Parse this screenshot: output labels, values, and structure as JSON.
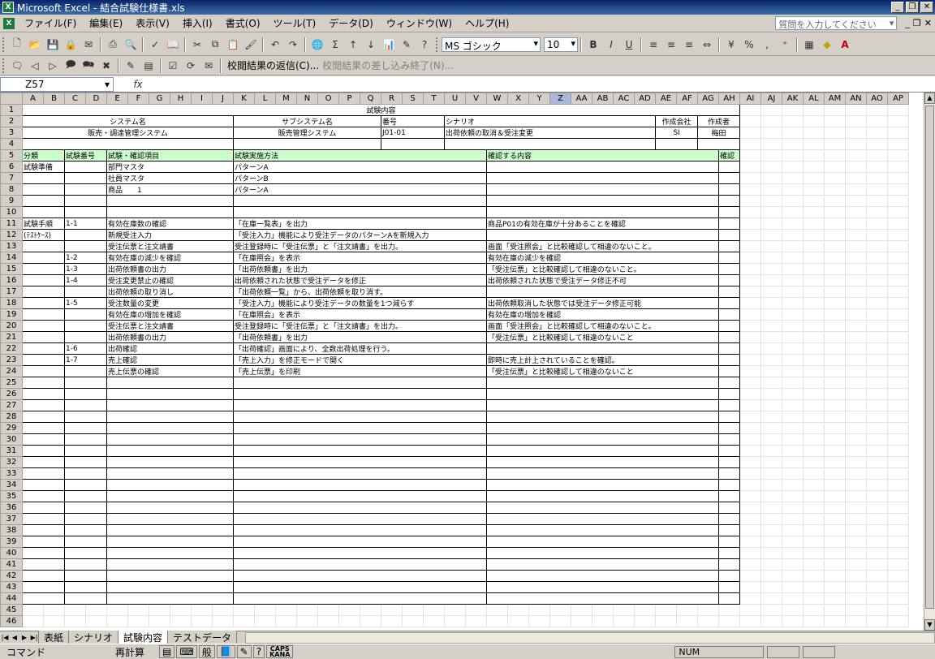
{
  "window": {
    "title": "Microsoft Excel - 結合試験仕様書.xls",
    "icon": "excel-icon"
  },
  "menubar": {
    "items": [
      "ファイル(F)",
      "編集(E)",
      "表示(V)",
      "挿入(I)",
      "書式(O)",
      "ツール(T)",
      "データ(D)",
      "ウィンドウ(W)",
      "ヘルプ(H)"
    ],
    "help_placeholder": "質問を入力してください"
  },
  "toolbar": {
    "font": "MS ゴシック",
    "size": "10",
    "reviewing_reply": "校閲結果の返信(C)...",
    "end_review": "校閲結果の差し込み終了(N)..."
  },
  "formula": {
    "name_box": "Z57",
    "fx": "fx",
    "value": ""
  },
  "columns": [
    "A",
    "B",
    "C",
    "D",
    "E",
    "F",
    "G",
    "H",
    "I",
    "J",
    "K",
    "L",
    "M",
    "N",
    "O",
    "P",
    "Q",
    "R",
    "S",
    "T",
    "U",
    "V",
    "W",
    "X",
    "Y",
    "Z",
    "AA",
    "AB",
    "AC",
    "AD",
    "AE",
    "AF",
    "AG",
    "AH",
    "AI",
    "AJ",
    "AK",
    "AL",
    "AM",
    "AN",
    "AO",
    "AP"
  ],
  "selected_column": "Z",
  "sheet": {
    "title": "試験内容",
    "hdr_system": "システム名",
    "hdr_subsystem": "サブシステム名",
    "hdr_number": "番号",
    "hdr_scenario": "シナリオ",
    "hdr_company": "作成会社",
    "hdr_author": "作成者",
    "system": "販売・調達管理システム",
    "subsystem": "販売管理システム",
    "number": "J01-01",
    "scenario": "出荷依頼の取消＆受注変更",
    "company": "SI",
    "author": "梅田",
    "col_category": "分類",
    "col_testno": "試験番号",
    "col_item": "試験・確認項目",
    "col_method": "試験実施方法",
    "col_check": "確認する内容",
    "col_confirm": "確認",
    "rows": [
      {
        "r": 6,
        "cat": "試験準備",
        "no": "",
        "item": "部門マスタ",
        "method": "パターンA",
        "check": ""
      },
      {
        "r": 7,
        "cat": "",
        "no": "",
        "item": "社員マスタ",
        "method": "パターンB",
        "check": ""
      },
      {
        "r": 8,
        "cat": "",
        "no": "",
        "item": "商品　　1",
        "method": "パターンA",
        "check": ""
      },
      {
        "r": 9,
        "cat": "",
        "no": "",
        "item": "",
        "method": "",
        "check": ""
      },
      {
        "r": 10,
        "cat": "",
        "no": "",
        "item": "",
        "method": "",
        "check": ""
      },
      {
        "r": 11,
        "cat": "試験手順",
        "no": "1-1",
        "item": "有効在庫数の確認",
        "method": "「在庫一覧表」を出力",
        "check": "商品P01の有効在庫が十分あることを確認"
      },
      {
        "r": 12,
        "cat": "(ﾃｽﾄｹｰｽ)",
        "no": "",
        "item": "新規受注入力",
        "method": "「受注入力」機能により受注データのパターンAを新規入力",
        "check": ""
      },
      {
        "r": 13,
        "cat": "",
        "no": "",
        "item": "受注伝票と注文請書",
        "method": "受注登録時に「受注伝票」と「注文請書」を出力。",
        "check": "画面「受注照会」と比較確認して相違のないこと。"
      },
      {
        "r": 14,
        "cat": "",
        "no": "1-2",
        "item": "有効在庫の減少を確認",
        "method": "「在庫照会」を表示",
        "check": "有効在庫の減少を確認"
      },
      {
        "r": 15,
        "cat": "",
        "no": "1-3",
        "item": "出荷依頼書の出力",
        "method": "「出荷依頼書」を出力",
        "check": "「受注伝票」と比較確認して相違のないこと。"
      },
      {
        "r": 16,
        "cat": "",
        "no": "1-4",
        "item": "受注変更禁止の確認",
        "method": "出荷依頼された状態で受注データを修正",
        "check": "出荷依頼された状態で受注データ修正不可"
      },
      {
        "r": 17,
        "cat": "",
        "no": "",
        "item": "出荷依頼の取り消し",
        "method": "「出荷依頼一覧」から、出荷依頼を取り消す。",
        "check": ""
      },
      {
        "r": 18,
        "cat": "",
        "no": "1-5",
        "item": "受注数量の変更",
        "method": "「受注入力」機能により受注データの数量を1つ減らす",
        "check": "出荷依頼取消した状態では受注データ修正可能"
      },
      {
        "r": 19,
        "cat": "",
        "no": "",
        "item": "有効在庫の増加を確認",
        "method": "「在庫照会」を表示",
        "check": "有効在庫の増加を確認"
      },
      {
        "r": 20,
        "cat": "",
        "no": "",
        "item": "受注伝票と注文請書",
        "method": "受注登録時に「受注伝票」と「注文請書」を出力。",
        "check": "画面「受注照会」と比較確認して相違のないこと。"
      },
      {
        "r": 21,
        "cat": "",
        "no": "",
        "item": "出荷依頼書の出力",
        "method": "「出荷依頼書」を出力",
        "check": "「受注伝票」と比較確認して相違のないこと"
      },
      {
        "r": 22,
        "cat": "",
        "no": "1-6",
        "item": "出荷確認",
        "method": "「出荷確認」画面により、全数出荷処理を行う。",
        "check": ""
      },
      {
        "r": 23,
        "cat": "",
        "no": "1-7",
        "item": "売上確認",
        "method": "「売上入力」を修正モードで開く",
        "check": "即時に売上計上されていることを確認。"
      },
      {
        "r": 24,
        "cat": "",
        "no": "",
        "item": "売上伝票の確認",
        "method": "「売上伝票」を印刷",
        "check": "「受注伝票」と比較確認して相違のないこと"
      }
    ],
    "last_row": 44
  },
  "tabs": [
    "表紙",
    "シナリオ",
    "試験内容",
    "テストデータ"
  ],
  "active_tab": "試験内容",
  "status": {
    "mode": "コマンド",
    "recalc": "再計算",
    "ime_mode": "般",
    "caps": "CAPS",
    "kana": "KANA",
    "num": "NUM"
  }
}
